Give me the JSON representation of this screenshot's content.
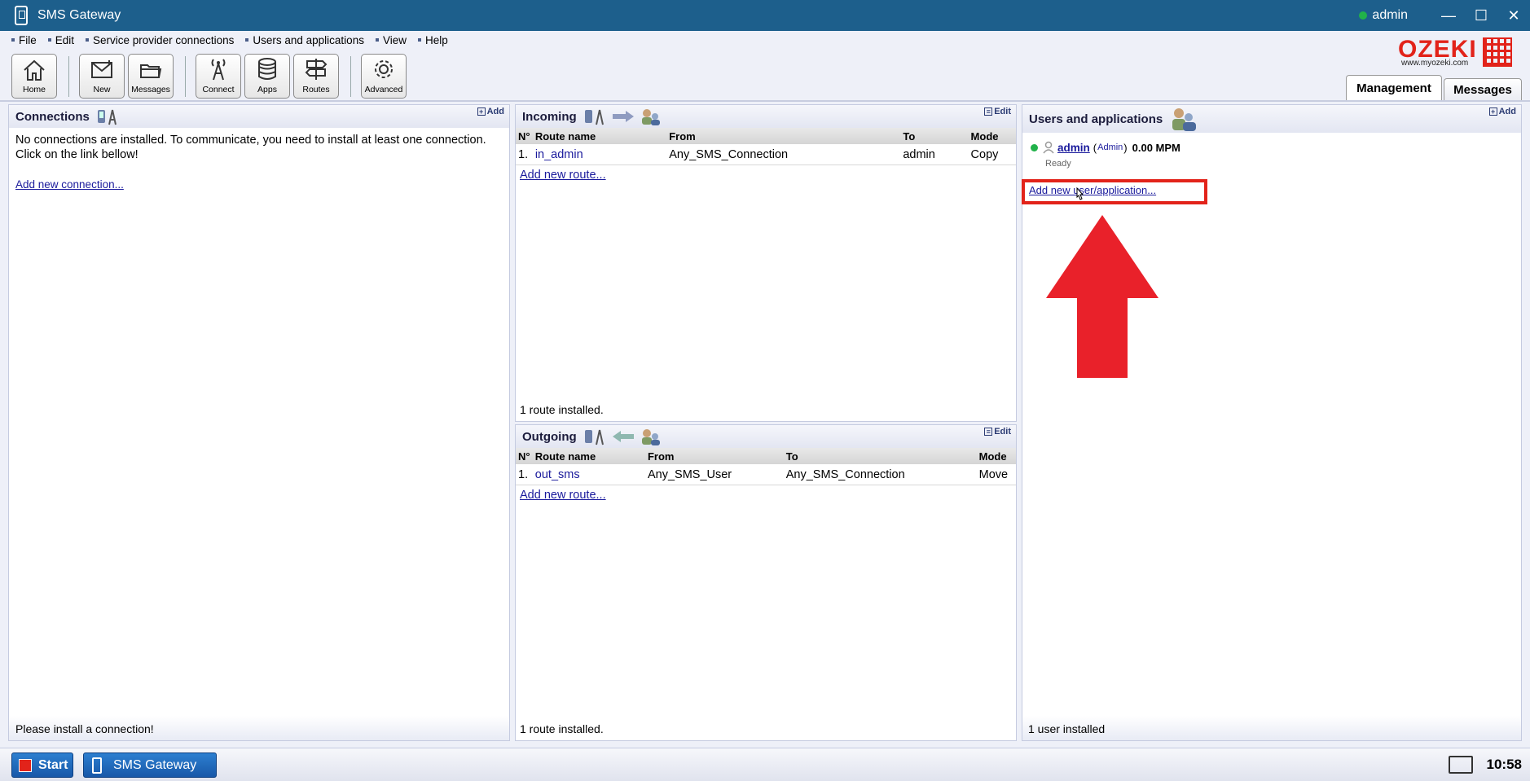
{
  "titlebar": {
    "title": "SMS Gateway",
    "user": "admin",
    "minimize": "—",
    "maximize": "☐",
    "close": "✕"
  },
  "menu": [
    "File",
    "Edit",
    "Service provider connections",
    "Users and applications",
    "View",
    "Help"
  ],
  "toolbar": {
    "home": "Home",
    "new": "New",
    "messages": "Messages",
    "connect": "Connect",
    "apps": "Apps",
    "routes": "Routes",
    "advanced": "Advanced"
  },
  "logo": {
    "brand": "OZEKI",
    "url": "www.myozeki.com"
  },
  "tabs": {
    "management": "Management",
    "messages": "Messages"
  },
  "connections": {
    "title": "Connections",
    "add": "Add",
    "message": "No connections are installed. To communicate, you need to install at least one connection. Click on the link bellow!",
    "link": "Add new connection...",
    "footer": "Please install a connection!"
  },
  "incoming": {
    "title": "Incoming",
    "edit": "Edit",
    "headers": {
      "num": "N°",
      "name": "Route name",
      "from": "From",
      "to": "To",
      "mode": "Mode"
    },
    "rows": [
      {
        "num": "1.",
        "name": "in_admin",
        "from": "Any_SMS_Connection",
        "to": "admin",
        "mode": "Copy"
      }
    ],
    "link": "Add new route...",
    "footer": "1 route installed."
  },
  "outgoing": {
    "title": "Outgoing",
    "edit": "Edit",
    "headers": {
      "num": "N°",
      "name": "Route name",
      "from": "From",
      "to": "To",
      "mode": "Mode"
    },
    "rows": [
      {
        "num": "1.",
        "name": "out_sms",
        "from": "Any_SMS_User",
        "to": "Any_SMS_Connection",
        "mode": "Move"
      }
    ],
    "link": "Add new route...",
    "footer": "1 route installed."
  },
  "users": {
    "title": "Users and applications",
    "add": "Add",
    "user_name": "admin",
    "user_role": "Admin",
    "paren_open": "(",
    "paren_close": ")",
    "user_rate": "0.00 MPM",
    "user_status": "Ready",
    "link": "Add new user/application...",
    "footer": "1 user installed"
  },
  "taskbar": {
    "start": "Start",
    "app": "SMS Gateway",
    "clock": "10:58"
  },
  "colors": {
    "titlebar": "#1d5f8c",
    "accent_red": "#e2231a",
    "status_online": "#21b24a",
    "link": "#1a1a9c"
  }
}
